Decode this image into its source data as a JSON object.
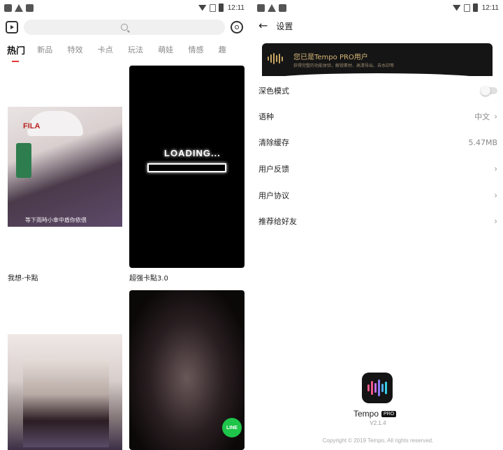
{
  "left": {
    "status": {
      "time": "12:11"
    },
    "search": {
      "placeholder": ""
    },
    "tabs": [
      "热门",
      "新品",
      "特效",
      "卡点",
      "玩法",
      "萌娃",
      "情感",
      "趣"
    ],
    "cards": [
      {
        "label": "我想-卡點",
        "overlay_text": "等下雨時小傘中盾你依偎"
      },
      {
        "label": "超强卡點3.0",
        "loading_text": "LOADING..."
      },
      {
        "label": ""
      },
      {
        "label": "",
        "badge": "LINE"
      }
    ]
  },
  "right": {
    "status": {
      "time": "12:11"
    },
    "header": {
      "title": "设置"
    },
    "pro_banner": {
      "title": "您已是Tempo PRO用户",
      "subtitle": "获得完整的功能体验，解锁素材、高清导出、去水印等"
    },
    "settings": [
      {
        "label": "深色模式",
        "value": "",
        "control": "toggle",
        "toggle_on": false
      },
      {
        "label": "语种",
        "value": "中文",
        "control": "chevron"
      },
      {
        "label": "清除缓存",
        "value": "5.47MB",
        "control": "none"
      },
      {
        "label": "用户反馈",
        "value": "",
        "control": "chevron"
      },
      {
        "label": "用户协议",
        "value": "",
        "control": "chevron"
      },
      {
        "label": "推荐给好友",
        "value": "",
        "control": "chevron"
      }
    ],
    "app": {
      "name": "Tempo",
      "badge": "PRO",
      "version": "V2.1.4",
      "copyright": "Copyright © 2019 Tempo, All rights reserved."
    }
  },
  "colors": {
    "accent_red": "#e53935",
    "pro_gold": "#d8b878",
    "line_green": "#1fc54a"
  }
}
